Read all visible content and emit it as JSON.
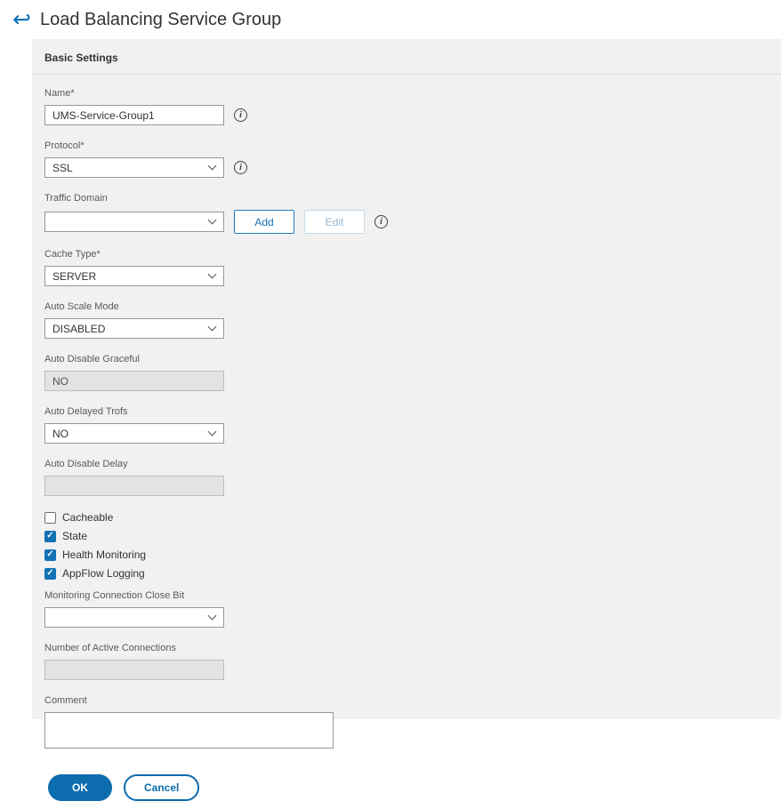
{
  "header": {
    "title": "Load Balancing Service Group"
  },
  "panel_title": "Basic Settings",
  "icons": {
    "back": "↩",
    "info": "i"
  },
  "fields": {
    "name": {
      "label": "Name*",
      "value": "UMS-Service-Group1"
    },
    "protocol": {
      "label": "Protocol*",
      "value": "SSL"
    },
    "traffic_domain": {
      "label": "Traffic Domain",
      "value": "",
      "add_label": "Add",
      "edit_label": "Edit"
    },
    "cache_type": {
      "label": "Cache Type*",
      "value": "SERVER"
    },
    "auto_scale_mode": {
      "label": "Auto Scale Mode",
      "value": "DISABLED"
    },
    "auto_disable_graceful": {
      "label": "Auto Disable Graceful",
      "value": "NO"
    },
    "auto_delayed_trofs": {
      "label": "Auto Delayed Trofs",
      "value": "NO"
    },
    "auto_disable_delay": {
      "label": "Auto Disable Delay",
      "value": ""
    },
    "monitoring_connection_close_bit": {
      "label": "Monitoring Connection Close Bit",
      "value": ""
    },
    "number_of_active_connections": {
      "label": "Number of Active Connections",
      "value": ""
    },
    "comment": {
      "label": "Comment",
      "value": ""
    }
  },
  "checkboxes": [
    {
      "label": "Cacheable",
      "checked": false
    },
    {
      "label": "State",
      "checked": true
    },
    {
      "label": "Health Monitoring",
      "checked": true
    },
    {
      "label": "AppFlow Logging",
      "checked": true
    }
  ],
  "actions": {
    "ok": "OK",
    "cancel": "Cancel"
  },
  "colors": {
    "accent": "#0d6cae",
    "panel_bg": "#f1f1f1"
  }
}
